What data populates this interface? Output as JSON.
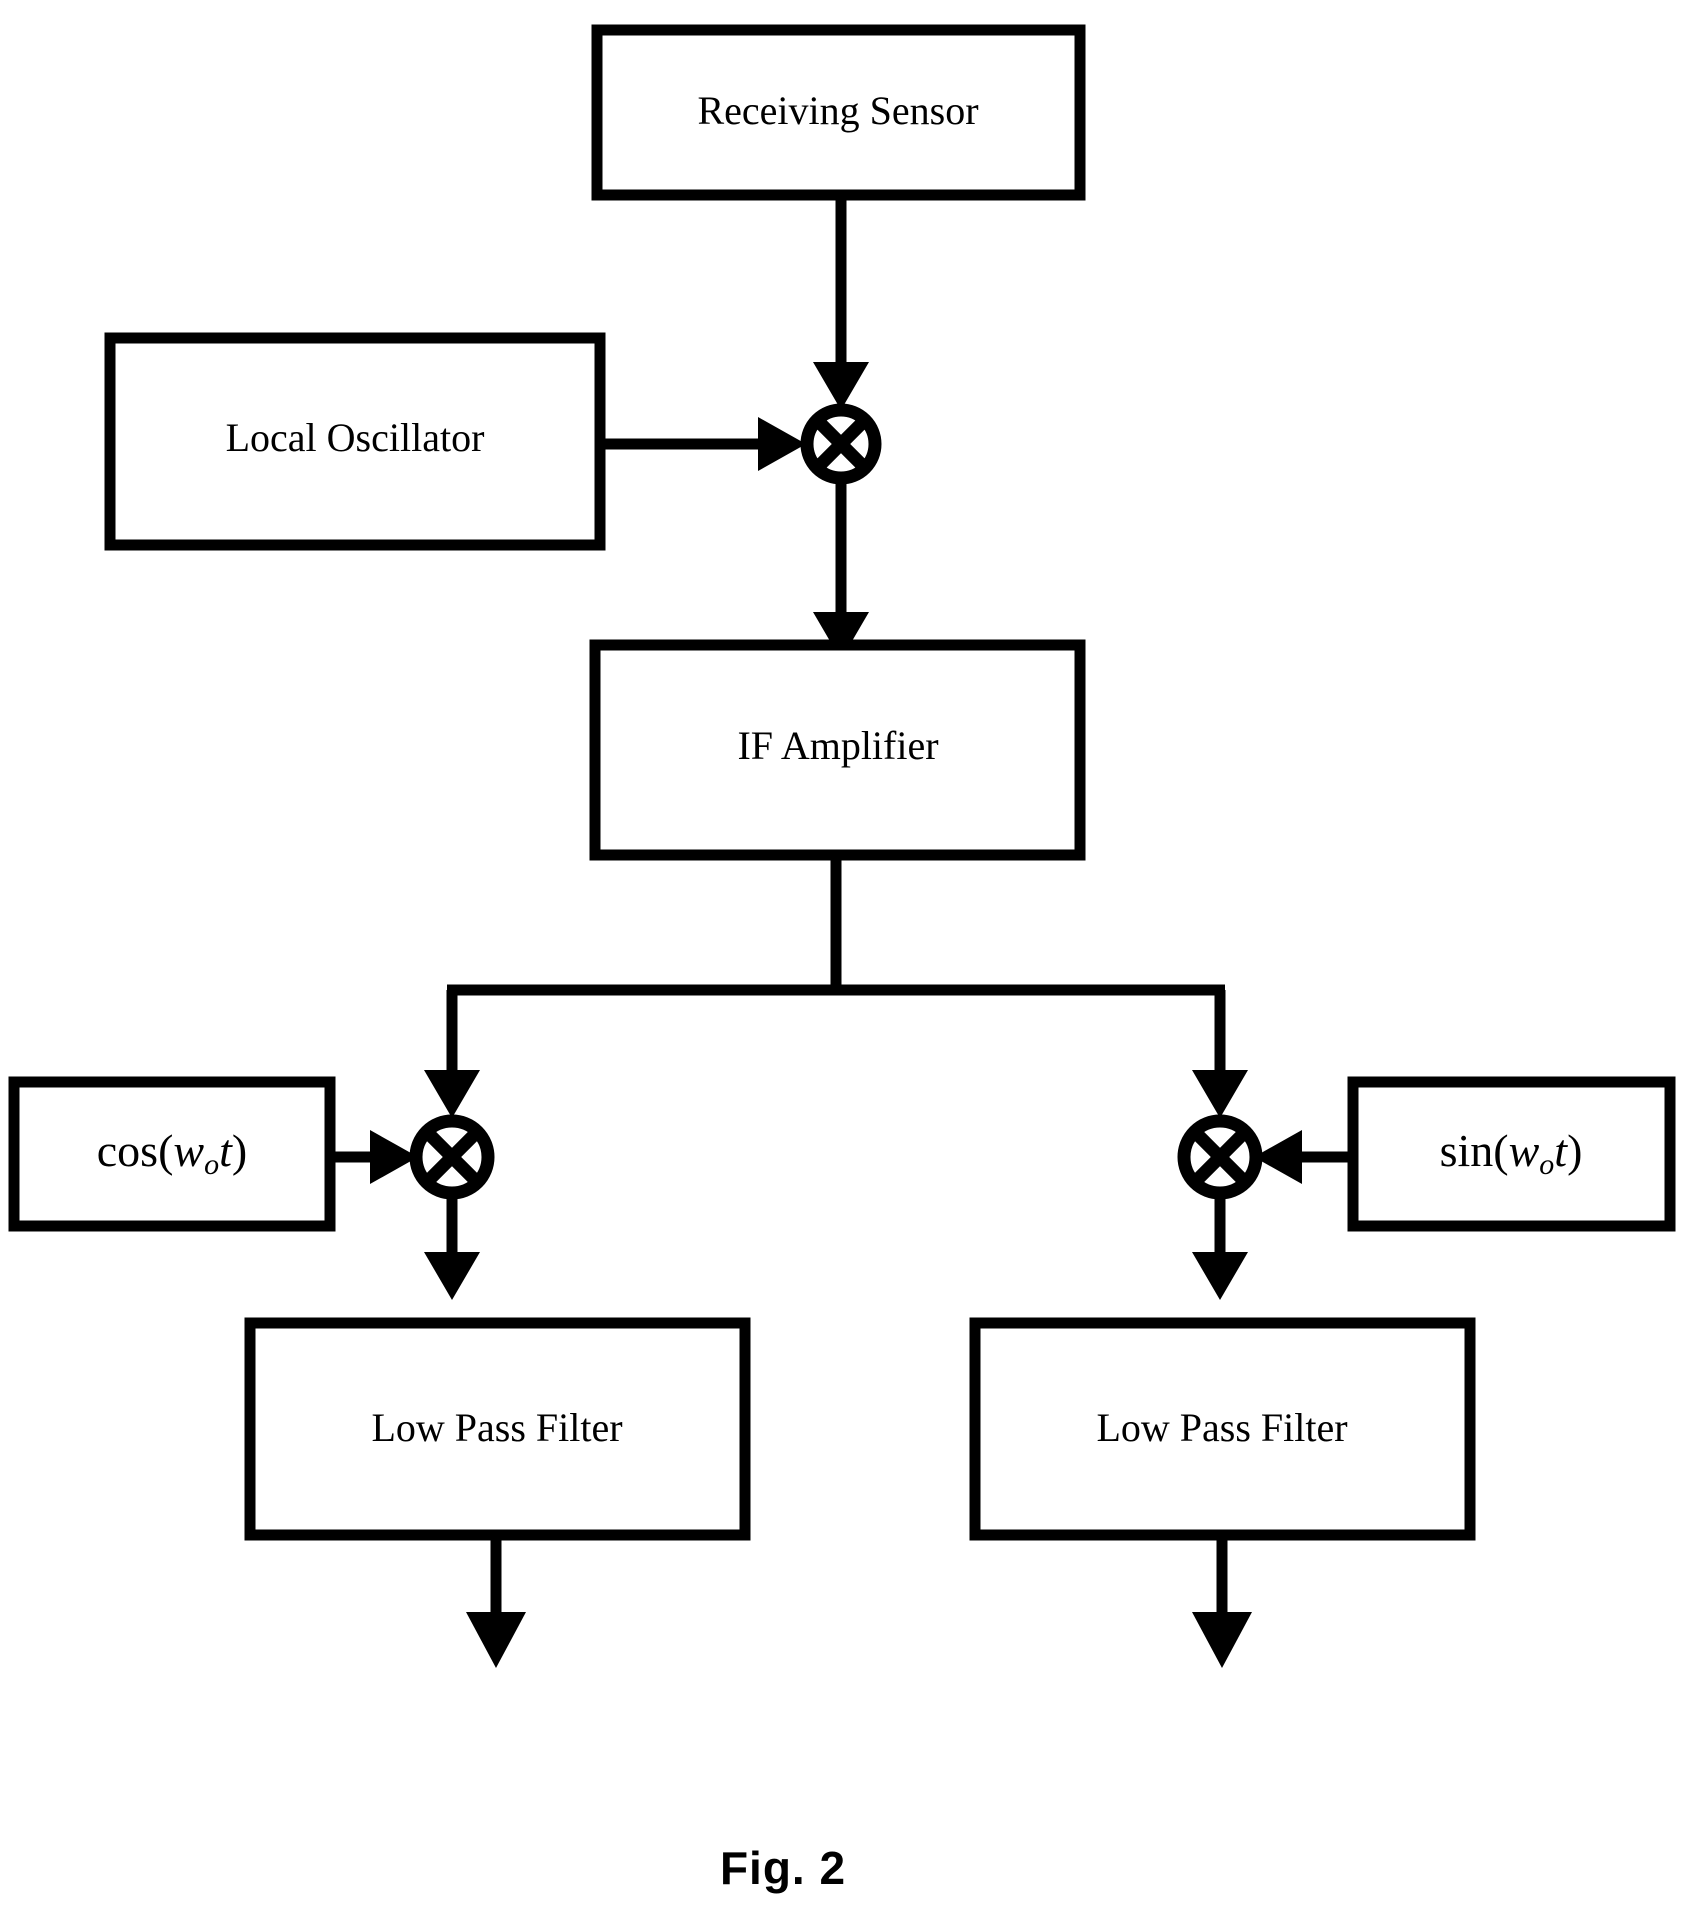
{
  "figure": {
    "caption": "Fig. 2",
    "background_color": "#ffffff",
    "line_color": "#000000"
  },
  "blocks": {
    "receiving_sensor": {
      "label": "Receiving Sensor"
    },
    "local_oscillator": {
      "label": "Local Oscillator"
    },
    "if_amplifier": {
      "label": "IF Amplifier"
    },
    "cos_source": {
      "function": "cos",
      "open_paren": "(",
      "variable": "w",
      "subscript": "o",
      "time": "t",
      "close_paren": ")"
    },
    "sin_source": {
      "function": "sin",
      "open_paren": "(",
      "variable": "w",
      "subscript": "o",
      "time": "t",
      "close_paren": ")"
    },
    "low_pass_filter_i": {
      "label": "Low Pass Filter"
    },
    "low_pass_filter_q": {
      "label": "Low Pass Filter"
    }
  },
  "mixers": {
    "rf_mixer": {
      "symbol": "circle-times"
    },
    "i_mixer": {
      "symbol": "circle-times"
    },
    "q_mixer": {
      "symbol": "circle-times"
    }
  }
}
